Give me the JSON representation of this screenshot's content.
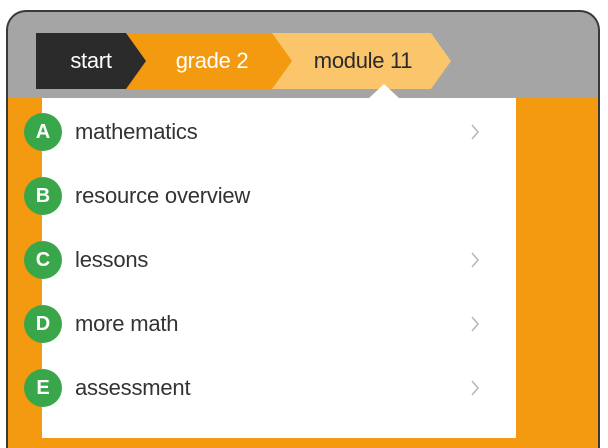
{
  "breadcrumb": {
    "items": [
      {
        "label": "start",
        "color": "#2b2b2b"
      },
      {
        "label": "grade 2",
        "color": "#f39a10"
      },
      {
        "label": "module 11",
        "color": "#fbc56b"
      }
    ]
  },
  "menu": {
    "items": [
      {
        "badge": "A",
        "label": "mathematics",
        "has_chevron": true
      },
      {
        "badge": "B",
        "label": "resource overview",
        "has_chevron": false
      },
      {
        "badge": "C",
        "label": "lessons",
        "has_chevron": true
      },
      {
        "badge": "D",
        "label": "more math",
        "has_chevron": true
      },
      {
        "badge": "E",
        "label": "assessment",
        "has_chevron": true
      }
    ],
    "chevron_icon": "chevron-right-icon"
  },
  "colors": {
    "frame_gray": "#a5a5a5",
    "accent_orange": "#f39a10",
    "badge_green": "#3aa64a",
    "menu_bg": "#ffffff"
  }
}
